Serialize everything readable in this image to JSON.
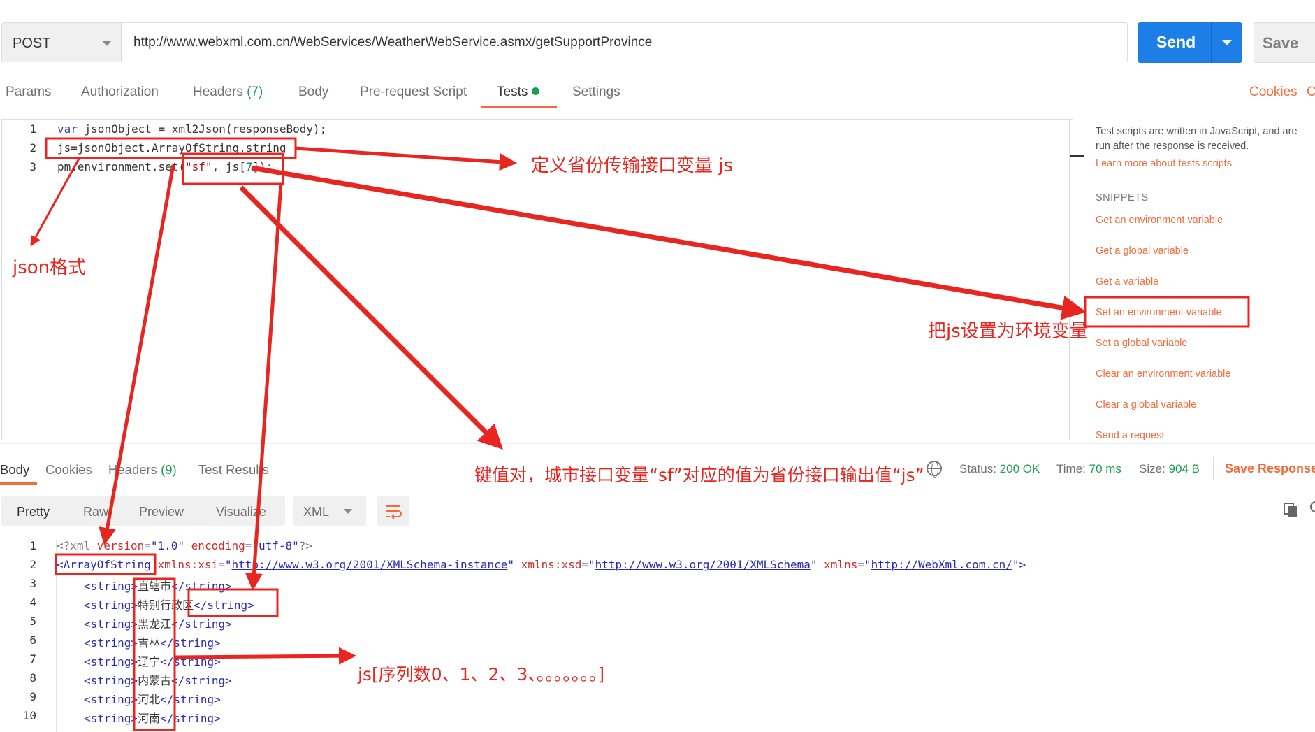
{
  "request": {
    "method": "POST",
    "url": "http://www.webxml.com.cn/WebServices/WeatherWebService.asmx/getSupportProvince",
    "send_label": "Send",
    "save_label": "Save"
  },
  "tabs": [
    {
      "label": "Params"
    },
    {
      "label": "Authorization"
    },
    {
      "label": "Headers",
      "count": "(7)"
    },
    {
      "label": "Body"
    },
    {
      "label": "Pre-request Script"
    },
    {
      "label": "Tests",
      "active": true
    },
    {
      "label": "Settings"
    }
  ],
  "cookies_label": "Cookies",
  "code_label": "C",
  "editor": {
    "line_numbers": [
      "1",
      "2",
      "3"
    ],
    "lines": [
      {
        "kw": "var",
        "rest": " jsonObject = xml2Json(responseBody);"
      },
      {
        "rest": "js=jsonObject.ArrayOfString.string"
      },
      {
        "pre": "pm.environment.set(",
        "s1": "\"sf\"",
        "mid": ", js[",
        "n": "7",
        "post": "]);"
      }
    ]
  },
  "snippets": {
    "description": "Test scripts are written in JavaScript, and are run after the response is received.",
    "learn_more": "Learn more about tests scripts",
    "heading": "SNIPPETS",
    "items": [
      "Get an environment variable",
      "Get a global variable",
      "Get a variable",
      "Set an environment variable",
      "Set a global variable",
      "Clear an environment variable",
      "Clear a global variable",
      "Send a request"
    ]
  },
  "response": {
    "tabs": [
      {
        "label": "Body"
      },
      {
        "label": "Cookies"
      },
      {
        "label": "Headers",
        "count": "(9)"
      },
      {
        "label": "Test Results"
      }
    ],
    "status_label": "Status:",
    "status_value": "200 OK",
    "time_label": "Time:",
    "time_value": "70 ms",
    "size_label": "Size:",
    "size_value": "904 B",
    "save_response": "Save Response",
    "view_modes": [
      "Pretty",
      "Raw",
      "Preview",
      "Visualize"
    ],
    "format": "XML",
    "line_numbers": [
      "1",
      "2",
      "3",
      "4",
      "5",
      "6",
      "7",
      "8",
      "9",
      "10"
    ],
    "xml": {
      "decl": {
        "open": "<?xml ",
        "a1": "version",
        "v1": "=\"1.0\" ",
        "a2": "encoding",
        "v2": "=\"utf-8\"",
        "close": "?>"
      },
      "root": {
        "tag": "<ArrayOfString",
        "a1": " xmlns:xsi",
        "v1_pre": "=\"",
        "v1": "http://www.w3.org/2001/XMLSchema-instance",
        "v1_post": "\"",
        "a2": " xmlns:xsd",
        "v2_pre": "=\"",
        "v2": "http://www.w3.org/2001/XMLSchema",
        "v2_post": "\"",
        "a3": " xmlns",
        "v3_pre": "=\"",
        "v3": "http://WebXml.com.cn/",
        "v3_post": "\">"
      },
      "open_tag": "<string>",
      "close_tag": "</string>",
      "items": [
        "直辖市",
        "特别行政区",
        "黑龙江",
        "吉林",
        "辽宁",
        "内蒙古",
        "河北",
        "河南"
      ]
    }
  },
  "annotations": {
    "define_var": "定义省份传输接口变量 js",
    "json_format": "json格式",
    "set_env": "把js设置为环境变量",
    "kv_pair": "键值对，城市接口变量“sf”对应的值为省份接口输出值“js”",
    "index_note": "js[序列数0、1、2、3、。。。。。。。]",
    "color": "#e8251f"
  }
}
